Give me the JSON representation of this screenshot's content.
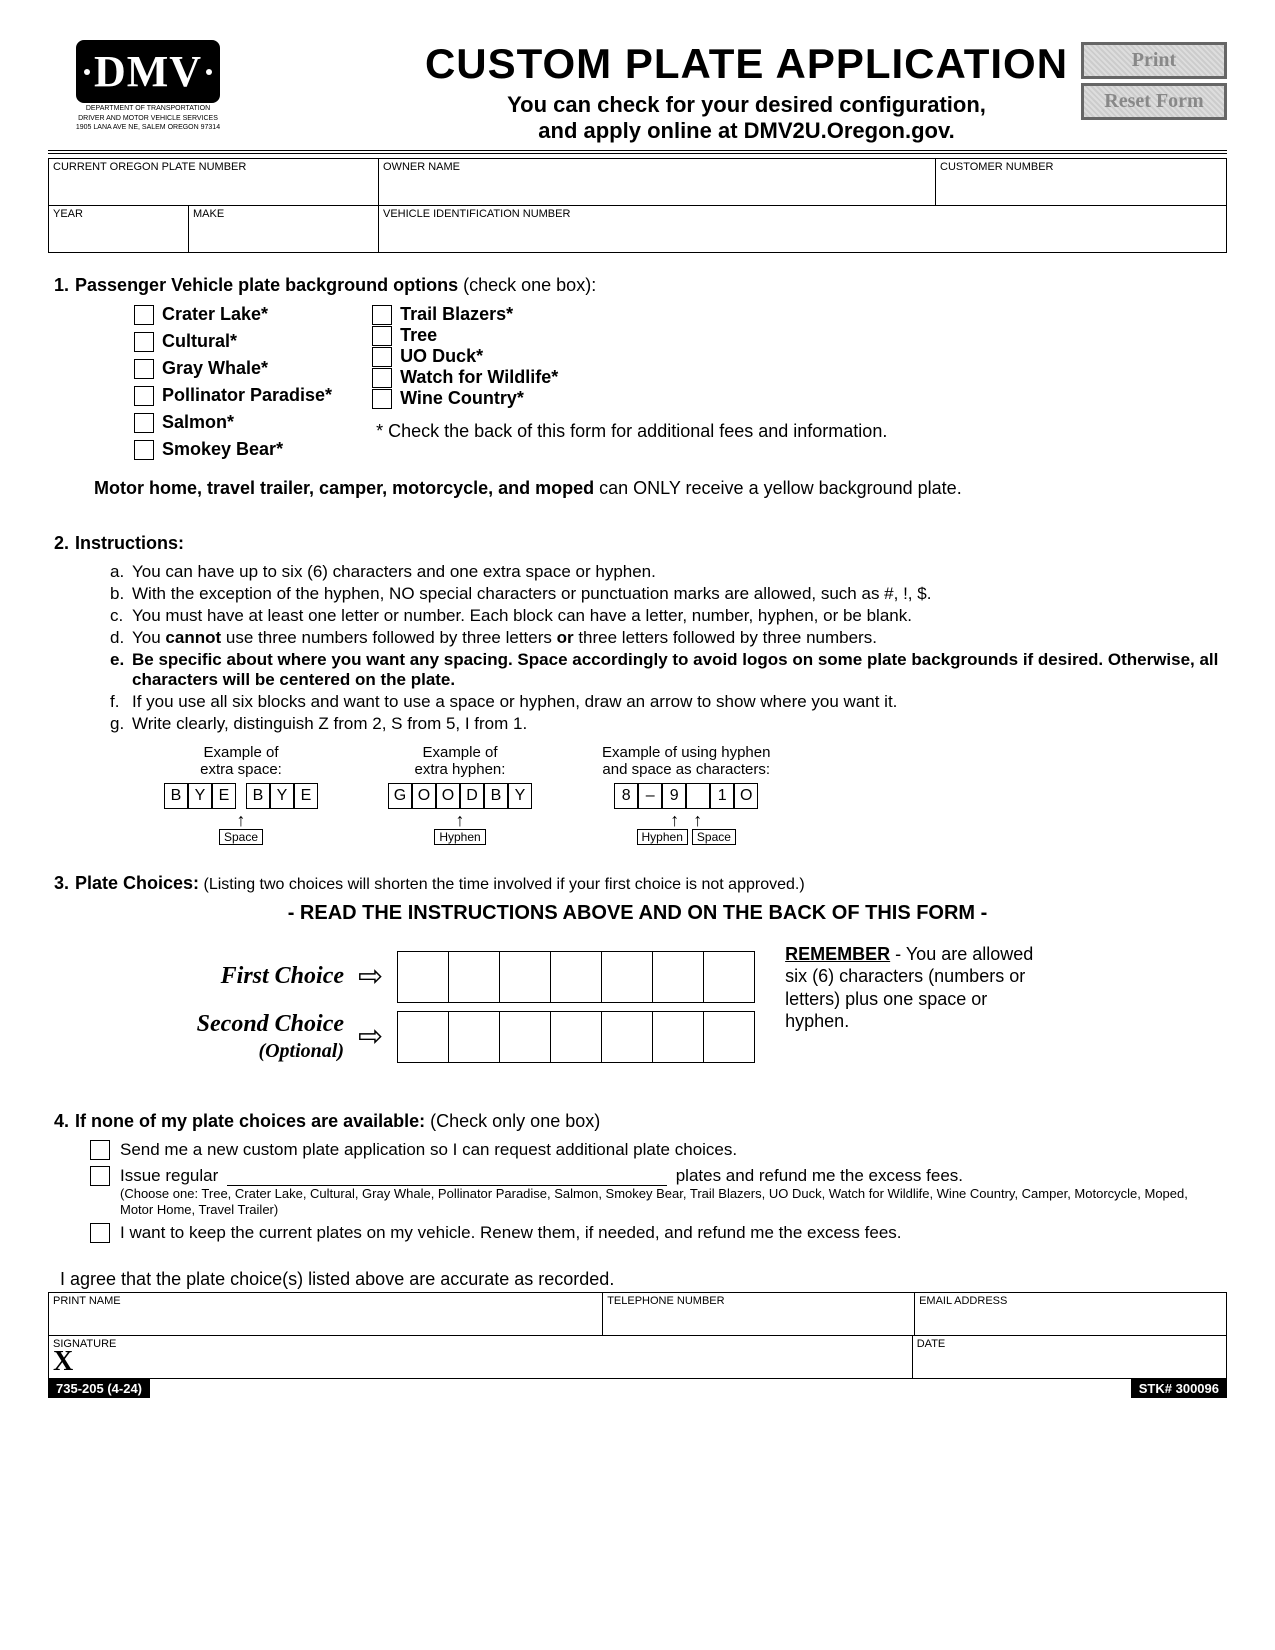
{
  "buttons": {
    "print": "Print",
    "reset": "Reset Form"
  },
  "logo": {
    "text": "DMV",
    "sub1": "DEPARTMENT OF TRANSPORTATION",
    "sub2": "DRIVER AND MOTOR VEHICLE SERVICES",
    "sub3": "1905 LANA AVE NE, SALEM OREGON 97314"
  },
  "title": {
    "main": "CUSTOM PLATE APPLICATION",
    "sub1": "You can check for your desired configuration,",
    "sub2": "and apply online at DMV2U.Oregon.gov."
  },
  "fields": {
    "plate": "CURRENT OREGON PLATE NUMBER",
    "owner": "OWNER NAME",
    "cust": "CUSTOMER NUMBER",
    "year": "YEAR",
    "make": "MAKE",
    "vin": "VEHICLE IDENTIFICATION NUMBER"
  },
  "sec1": {
    "num": "1.",
    "title": "Passenger Vehicle plate background options",
    "suffix": " (check one box):",
    "left": [
      "Crater Lake*",
      "Cultural*",
      "Gray Whale*",
      "Pollinator Paradise*",
      "Salmon*",
      "Smokey Bear*"
    ],
    "right": [
      "Trail Blazers*",
      "Tree",
      "UO Duck*",
      "Watch for Wildlife*",
      "Wine Country*"
    ],
    "note": "* Check the back of this form for additional fees and information.",
    "motor_b": "Motor home, travel trailer, camper, motorcycle, and moped",
    "motor_t": " can ONLY receive a yellow background plate."
  },
  "sec2": {
    "num": "2.",
    "title": "Instructions:",
    "items": [
      {
        "l": "a.",
        "t": "You can have up to six (6) characters and one extra space or hyphen.",
        "b": false
      },
      {
        "l": "b.",
        "t": "With the exception of the hyphen, NO special characters or punctuation marks are allowed, such as #, !, $.",
        "b": false
      },
      {
        "l": "c.",
        "t": "You must have at least one letter or number. Each block can have a letter, number, hyphen, or be blank.",
        "b": false
      },
      {
        "l": "d.",
        "t": "You cannot use three numbers followed by three letters or three letters followed by three numbers.",
        "b": false
      },
      {
        "l": "e.",
        "t": "Be specific about where you want any spacing. Space accordingly to avoid logos on some plate backgrounds if desired. Otherwise, all characters will be centered on the plate.",
        "b": true
      },
      {
        "l": "f.",
        "t": "If you use all six blocks and want to use a space or hyphen, draw an arrow to show where you want it.",
        "b": false
      },
      {
        "l": "g.",
        "t": "Write clearly, distinguish Z from 2, S from 5, I from 1.",
        "b": false
      }
    ],
    "ex1": {
      "t1": "Example of",
      "t2": "extra space:",
      "chars": [
        "B",
        "Y",
        "E",
        "B",
        "Y",
        "E"
      ],
      "tag": "Space"
    },
    "ex2": {
      "t1": "Example of",
      "t2": "extra hyphen:",
      "chars": [
        "G",
        "O",
        "O",
        "D",
        "B",
        "Y"
      ],
      "tag": "Hyphen"
    },
    "ex3": {
      "t1": "Example of using hyphen",
      "t2": "and space as characters:",
      "chars": [
        "8",
        "–",
        "9",
        "",
        "1",
        "O"
      ],
      "tag1": "Hyphen",
      "tag2": "Space"
    }
  },
  "sec3": {
    "num": "3.",
    "title": "Plate Choices:",
    "sub": "  (Listing two choices will shorten the time involved if your first choice is not approved.)",
    "banner": "- READ THE INSTRUCTIONS ABOVE AND ON THE BACK OF THIS FORM -",
    "first": "First Choice",
    "second": "Second Choice",
    "opt": "(Optional)",
    "rem_b": "REMEMBER",
    "rem_t": " - You are allowed six (6) characters (numbers or letters) plus one space or hyphen."
  },
  "sec4": {
    "num": "4.",
    "title": "If none of my plate choices are available:",
    "suffix": " (Check only one box)",
    "o1": "Send me a new custom plate application so I can request additional plate choices.",
    "o2a": "Issue regular ",
    "o2b": " plates and refund me the excess fees.",
    "o2sub": "(Choose one: Tree, Crater Lake, Cultural, Gray Whale, Pollinator Paradise, Salmon, Smokey Bear, Trail Blazers, UO Duck, Watch for Wildlife, Wine Country, Camper, Motorcycle, Moped, Motor Home, Travel Trailer)",
    "o3": "I want to keep the current plates on my vehicle. Renew them, if needed, and refund me the excess fees."
  },
  "agree": "I agree that the plate choice(s) listed above are accurate as recorded.",
  "sig": {
    "print": "PRINT NAME",
    "tel": "TELEPHONE NUMBER",
    "email": "EMAIL ADDRESS",
    "sig": "SIGNATURE",
    "date": "DATE",
    "x": "X"
  },
  "footer": {
    "left": "735-205 (4-24)",
    "right": "STK# 300096"
  }
}
